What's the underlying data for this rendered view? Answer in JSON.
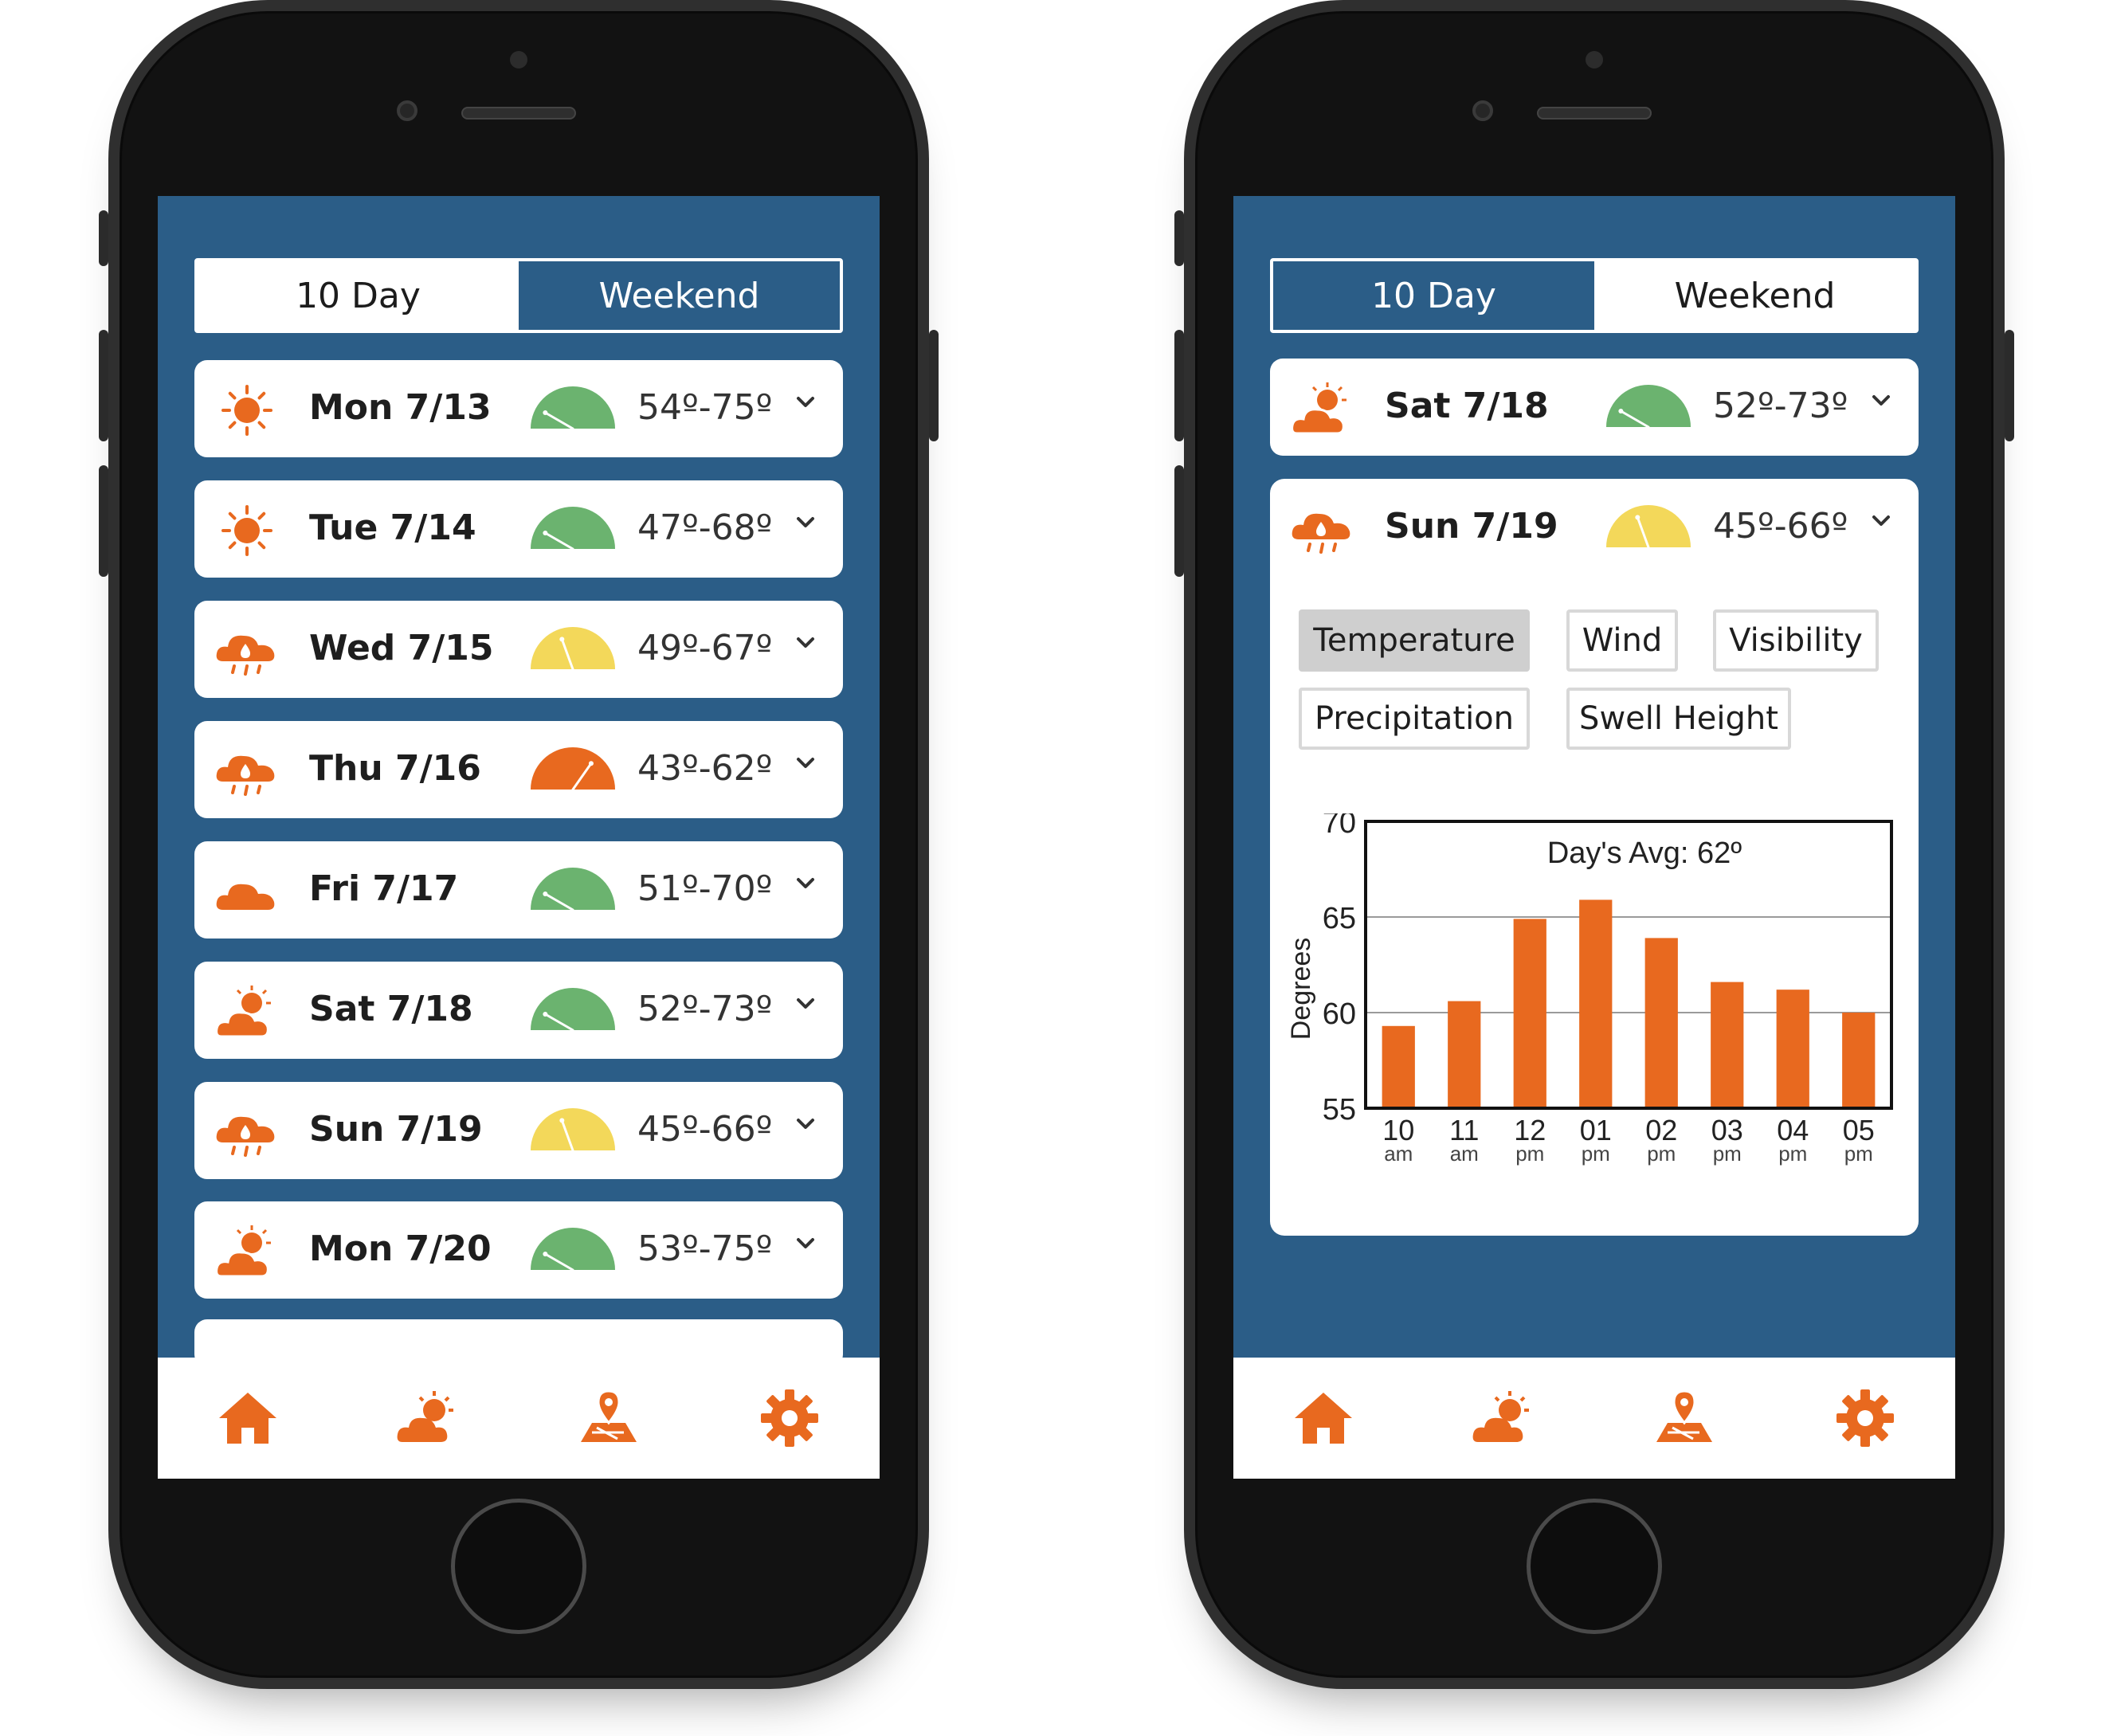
{
  "colors": {
    "screen_bg": "#2b5d87",
    "accent": "#e8691f",
    "good": "#6bb36f",
    "moderate": "#f3d85a",
    "poor": "#e8691f"
  },
  "left_phone": {
    "tabs": [
      {
        "label": "10 Day",
        "active": false
      },
      {
        "label": "Weekend",
        "active": true
      }
    ],
    "days": [
      {
        "label": "Mon 7/13",
        "temps": "54º-75º",
        "icon": "sun-icon",
        "rating": "good"
      },
      {
        "label": "Tue 7/14",
        "temps": "47º-68º",
        "icon": "sun-icon",
        "rating": "good"
      },
      {
        "label": "Wed 7/15",
        "temps": "49º-67º",
        "icon": "rain-cloud-icon",
        "rating": "moderate"
      },
      {
        "label": "Thu 7/16",
        "temps": "43º-62º",
        "icon": "rain-cloud-icon",
        "rating": "poor"
      },
      {
        "label": "Fri 7/17",
        "temps": "51º-70º",
        "icon": "cloud-icon",
        "rating": "good"
      },
      {
        "label": "Sat 7/18",
        "temps": "52º-73º",
        "icon": "partly-cloudy-icon",
        "rating": "good"
      },
      {
        "label": "Sun 7/19",
        "temps": "45º-66º",
        "icon": "rain-cloud-icon",
        "rating": "moderate"
      },
      {
        "label": "Mon 7/20",
        "temps": "53º-75º",
        "icon": "partly-cloudy-icon",
        "rating": "good"
      }
    ]
  },
  "right_phone": {
    "tabs": [
      {
        "label": "10 Day",
        "active": true
      },
      {
        "label": "Weekend",
        "active": false
      }
    ],
    "days": [
      {
        "label": "Sat 7/18",
        "temps": "52º-73º",
        "icon": "partly-cloudy-icon",
        "rating": "good"
      },
      {
        "label": "Sun 7/19",
        "temps": "45º-66º",
        "icon": "rain-cloud-icon",
        "rating": "moderate"
      }
    ],
    "metric_buttons": [
      {
        "label": "Temperature",
        "active": true
      },
      {
        "label": "Wind",
        "active": false
      },
      {
        "label": "Visibility",
        "active": false
      },
      {
        "label": "Precipitation",
        "active": false
      },
      {
        "label": "Swell Height",
        "active": false
      }
    ]
  },
  "nav": {
    "items": [
      "home-icon",
      "forecast-icon",
      "map-pin-icon",
      "settings-gear-icon"
    ]
  },
  "chart_data": {
    "type": "bar",
    "title": "Day's Avg: 62º",
    "ylabel": "Degrees",
    "xlabel": "",
    "ylim": [
      55,
      70
    ],
    "yticks": [
      "55",
      "60",
      "65",
      "70"
    ],
    "grid": true,
    "categories": [
      "10 am",
      "11 am",
      "12 pm",
      "01 pm",
      "02 pm",
      "03 pm",
      "04 pm",
      "05 pm"
    ],
    "category_hours": [
      "10",
      "11",
      "12",
      "01",
      "02",
      "03",
      "04",
      "05"
    ],
    "category_periods": [
      "am",
      "am",
      "pm",
      "pm",
      "pm",
      "pm",
      "pm",
      "pm"
    ],
    "values": [
      59.3,
      60.6,
      64.9,
      65.9,
      63.9,
      61.6,
      61.2,
      60.0
    ]
  }
}
